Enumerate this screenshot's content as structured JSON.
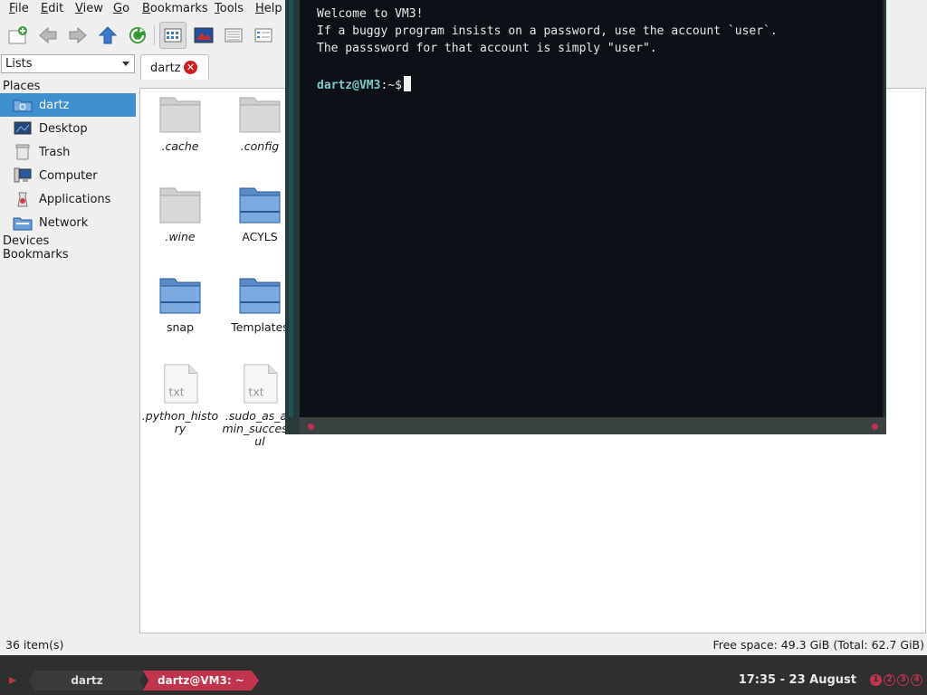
{
  "file_manager": {
    "menu": [
      "File",
      "Edit",
      "View",
      "Go",
      "Bookmarks",
      "Tools",
      "Help"
    ],
    "side_pane_mode": "Lists",
    "places_header": "Places",
    "places": [
      {
        "label": "dartz",
        "icon": "home-folder-icon",
        "selected": true
      },
      {
        "label": "Desktop",
        "icon": "desktop-icon",
        "selected": false
      },
      {
        "label": "Trash",
        "icon": "trash-icon",
        "selected": false
      },
      {
        "label": "Computer",
        "icon": "computer-icon",
        "selected": false
      },
      {
        "label": "Applications",
        "icon": "applications-icon",
        "selected": false
      },
      {
        "label": "Network",
        "icon": "network-icon",
        "selected": false
      }
    ],
    "devices_header": "Devices",
    "bookmarks_header": "Bookmarks",
    "tab": {
      "label": "dartz"
    },
    "files": [
      {
        "name": ".cache",
        "type": "folder-hidden"
      },
      {
        "name": ".config",
        "type": "folder-hidden"
      },
      {
        "name": ".wine",
        "type": "folder-hidden"
      },
      {
        "name": "ACYLS",
        "type": "folder"
      },
      {
        "name": "snap",
        "type": "folder"
      },
      {
        "name": "Templates",
        "type": "folder"
      },
      {
        "name": ".python_history",
        "type": "text"
      },
      {
        "name": ".sudo_as_admin_successful",
        "type": "text"
      }
    ],
    "status_count": "36 item(s)",
    "status_free": "Free space: 49.3 GiB (Total: 62.7 GiB)"
  },
  "terminal": {
    "line1": "Welcome to VM3!",
    "line2": "If a buggy program insists on a password, use the account `user`.",
    "line3": "The passsword for that account is simply \"user\".",
    "prompt_user": "dartz@VM3",
    "prompt_path": ":~$"
  },
  "panel": {
    "tasks": [
      "dartz",
      "dartz@VM3: ~"
    ],
    "clock": "17:35 - 23 August",
    "workspaces": [
      "1",
      "2",
      "3",
      "4"
    ],
    "accent": "#c0344e"
  }
}
